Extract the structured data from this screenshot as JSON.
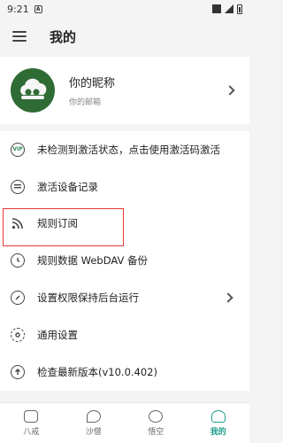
{
  "status_bar": {
    "time": "9:21",
    "notification_icon": "A"
  },
  "appbar": {
    "title": "我的"
  },
  "profile": {
    "nickname": "你的昵称",
    "email_label": "你的邮箱"
  },
  "menu": {
    "items": [
      {
        "label": "未检测到激活状态，点击使用激活码激活",
        "icon": "vip-icon",
        "icon_text": "VIP"
      },
      {
        "label": "激活设备记录",
        "icon": "list-icon"
      },
      {
        "label": "规则订阅",
        "icon": "rss-icon"
      },
      {
        "label": "规则数据 WebDAV 备份",
        "icon": "history-icon"
      },
      {
        "label": "设置权限保持后台运行",
        "icon": "power-icon"
      },
      {
        "label": "通用设置",
        "icon": "gear-icon"
      },
      {
        "label": "检查最新版本(v10.0.402)",
        "icon": "upgrade-icon"
      }
    ]
  },
  "tabs": [
    {
      "label": "八戒",
      "icon": "tag-icon"
    },
    {
      "label": "沙僧",
      "icon": "leaf-icon"
    },
    {
      "label": "悟空",
      "icon": "monkey-icon"
    },
    {
      "label": "我的",
      "icon": "person-icon",
      "active": true
    }
  ],
  "colors": {
    "accent": "#1e9c8c",
    "avatar_bg": "#2f6b35",
    "highlight_border": "#e53935"
  }
}
